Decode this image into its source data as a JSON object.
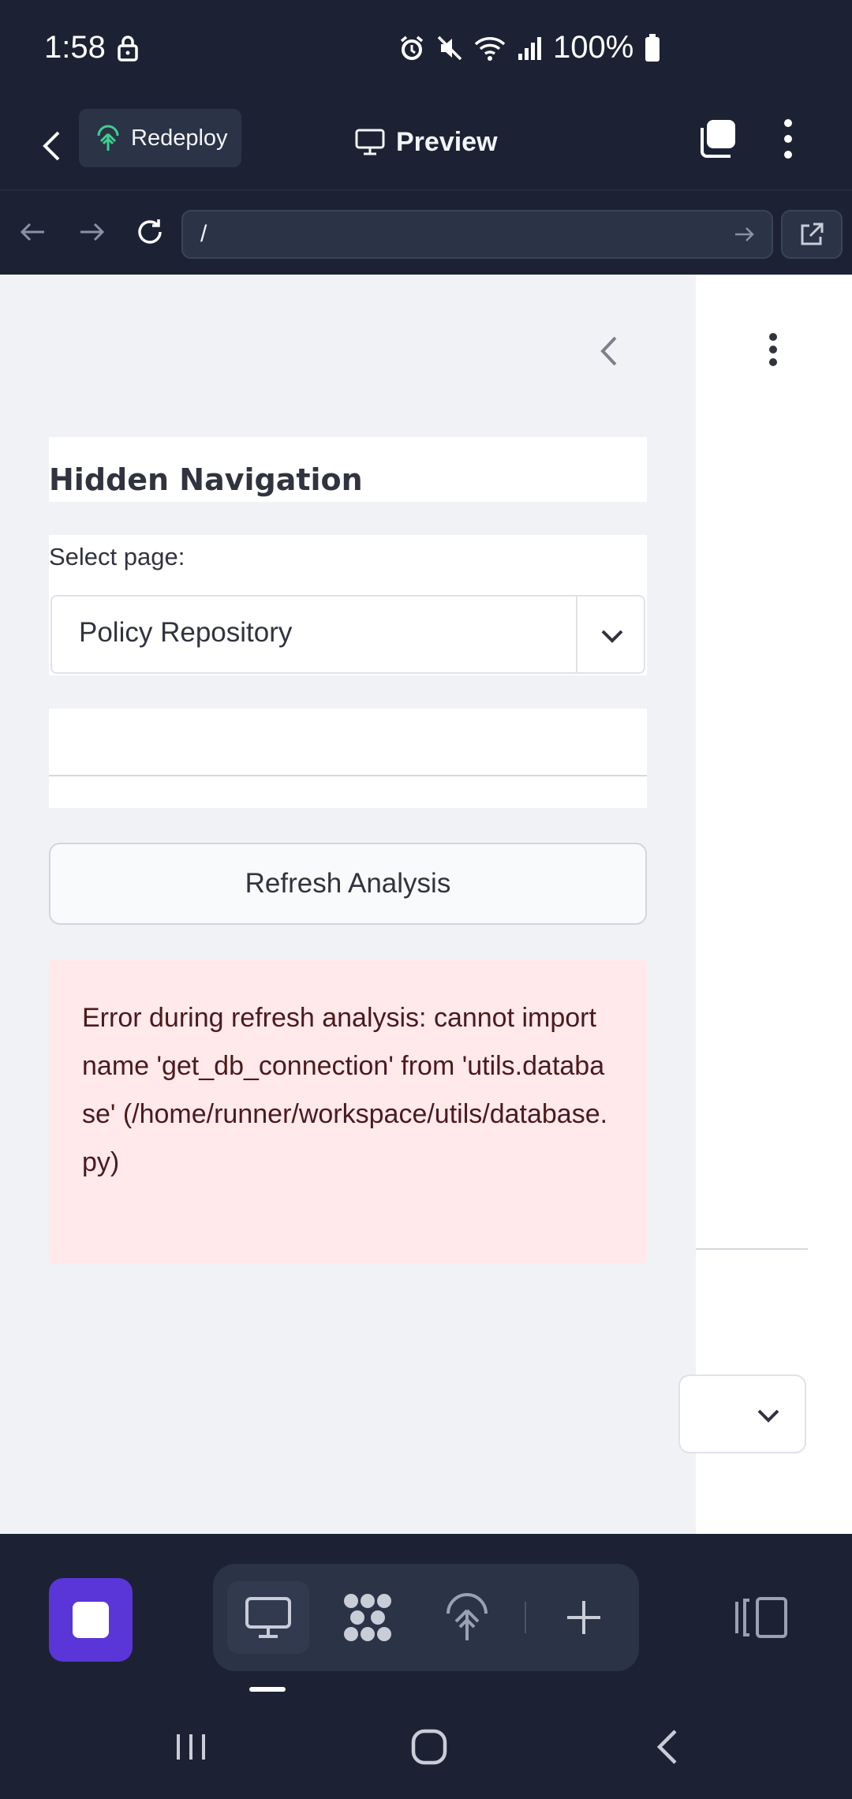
{
  "status_bar": {
    "time": "1:58",
    "battery": "100%"
  },
  "app_header": {
    "redeploy_label": "Redeploy",
    "title": "Preview"
  },
  "browser": {
    "url": "/"
  },
  "sidebar": {
    "heading": "Hidden Navigation",
    "select_label": "Select page:",
    "select_value": "Policy Repository",
    "refresh_button": "Refresh Analysis",
    "error_message": "Error during refresh analysis: cannot import name 'get_db_connection' from 'utils.database' (/home/runner/workspace/utils/database.py)"
  },
  "colors": {
    "chrome_bg": "#1c2233",
    "accent_purple": "#5a36d8",
    "sidebar_bg": "#f0f2f6",
    "error_bg": "#ffe9ea",
    "redeploy_icon": "#3ecf8e"
  },
  "icons": {
    "status": [
      "lock-icon",
      "alarm-icon",
      "mute-icon",
      "wifi-icon",
      "signal-icon",
      "battery-icon"
    ],
    "toolbar": [
      "desktop-icon",
      "extensions-icon",
      "deploy-icon",
      "plus-icon",
      "split-view-icon"
    ]
  }
}
